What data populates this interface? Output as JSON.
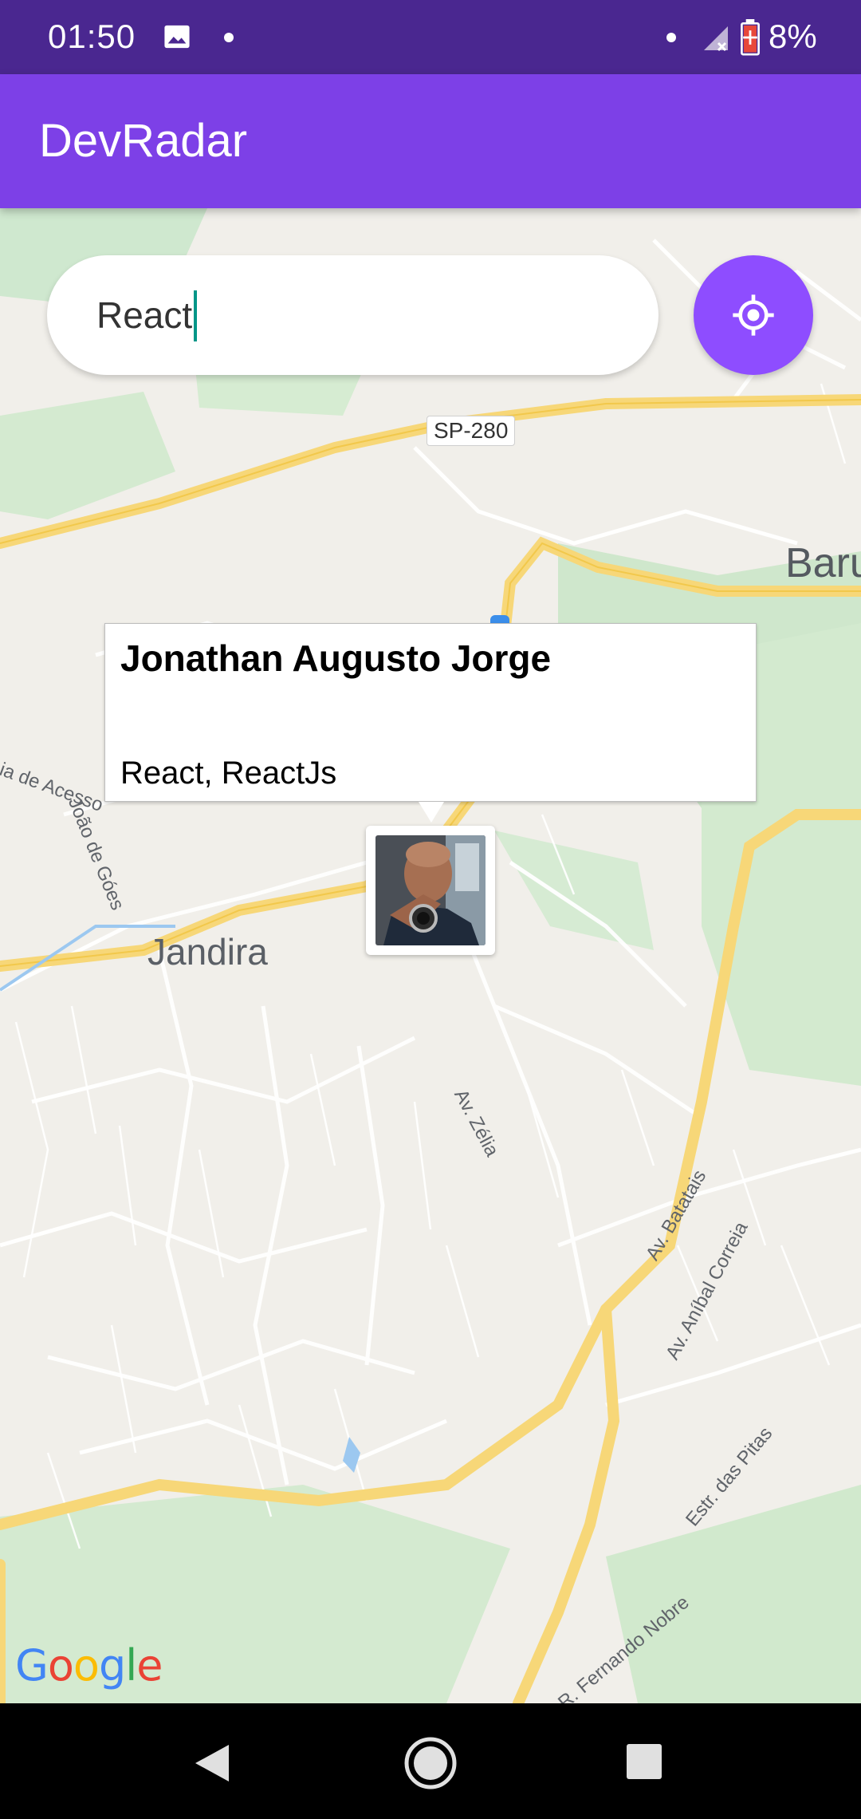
{
  "status_bar": {
    "time": "01:50",
    "battery": "8%",
    "icons": [
      "image-icon",
      "notification-dot-icon",
      "signal-icon",
      "battery-charging-icon"
    ]
  },
  "app_bar": {
    "title": "DevRadar",
    "color": "#7D40E7"
  },
  "search": {
    "value": "React",
    "placeholder": ""
  },
  "locate_button": {
    "icon": "my-location-icon",
    "color": "#8E4DFF"
  },
  "callout": {
    "name": "Jonathan Augusto Jorge",
    "techs": "React, ReactJs"
  },
  "map": {
    "labels": {
      "jandira": "Jandira",
      "baru": "Baru",
      "sp280": "SP-280",
      "av_zelia": "Av. Zélia",
      "av_batatais": "Av. Batatais",
      "av_anibal": "Av. Aníbal Correia",
      "estr_pita": "Estr. das Pitas",
      "r_fernando": "R. Fernando Nobre",
      "joao_goes": "João de Góes",
      "acesso": "ia de Acesso"
    },
    "provider": "Google"
  },
  "nav_bar": {
    "icons": [
      "back-icon",
      "home-icon",
      "recents-icon"
    ]
  }
}
